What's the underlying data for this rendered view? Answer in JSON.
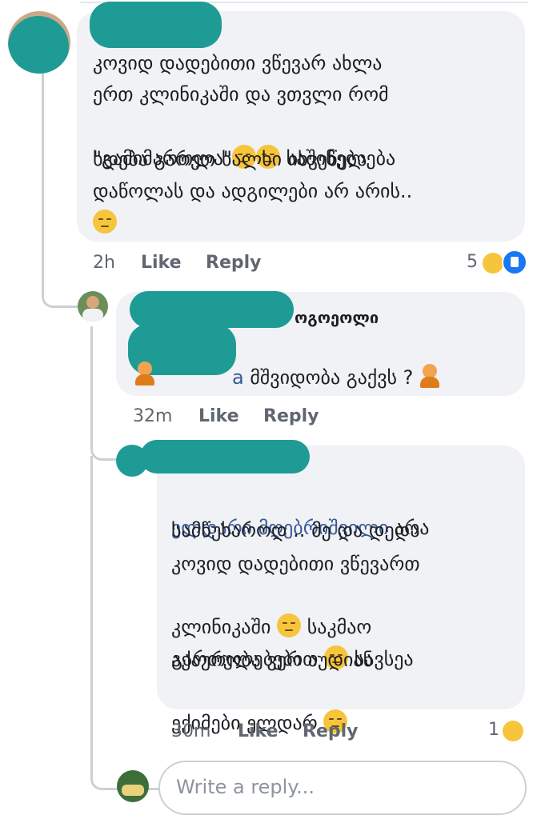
{
  "comments": [
    {
      "text_line1": "კოვიდ დადებითი ვწევარ ახლა",
      "text_line2": "ერთ კლინიკაში და ვთვლი რომ",
      "text_line3_a": "\"გამიმართლა\"",
      "text_line3_b": " საშინელება",
      "text_line4": "ხდება გარეთ ხალხი იხვეწება",
      "text_line5": "დაწოლას და ადგილები არ არის..",
      "time": "2h",
      "like_label": "Like",
      "reply_label": "Reply",
      "reaction_count": "5"
    },
    {
      "mention_tail": "a",
      "text_line1": " მშვიდობა გაქვს ? ",
      "header_fragment": "ოგოეოლი",
      "time": "32m",
      "like_label": "Like",
      "reply_label": "Reply"
    },
    {
      "mention": "ელდარი მღებრიშვილი",
      "text_line1_tail": " არა",
      "text_line2": "სამწუხაროდ .. მე და დედა",
      "text_line3": "კოვიდ დადებითი ვწევართ",
      "text_line4": "კლინიკაში ",
      "text_line4_tail": " საკმაო",
      "text_line5": "გართულებებით ",
      "text_line5_tail": " სავსეა",
      "text_line6": "აქაურობა ვერ აუდიან",
      "text_line7": "ექიმები ელდარ ",
      "time": "30m",
      "like_label": "Like",
      "reply_label": "Reply",
      "reaction_count": "1"
    }
  ],
  "reply_input": {
    "placeholder": "Write a reply..."
  },
  "colors": {
    "bubble": "#f0f2f5",
    "redaction": "#1e9b95",
    "link": "#385898",
    "like_blue": "#1877f2",
    "sad_yellow": "#f7c53b"
  },
  "icons": [
    "pensive-emoji",
    "facepalm-emoji",
    "expressionless-emoji",
    "pleading-emoji",
    "sad-reaction-icon",
    "like-reaction-icon"
  ]
}
